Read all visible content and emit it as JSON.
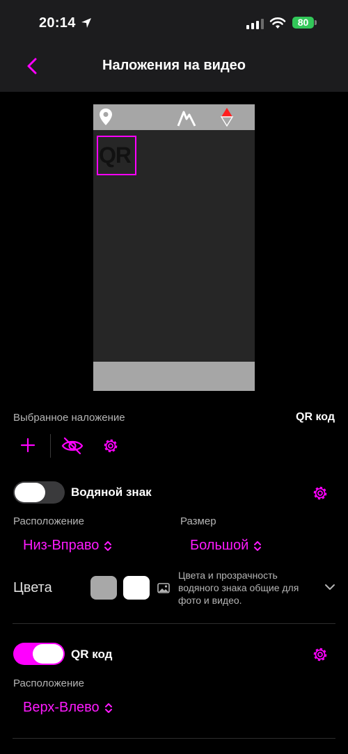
{
  "status_bar": {
    "time": "20:14",
    "battery": "80"
  },
  "nav": {
    "title": "Наложения на видео"
  },
  "selected_overlay": {
    "label": "Выбранное наложение",
    "value": "QR код"
  },
  "preview": {
    "qr_text": "QR"
  },
  "watermark": {
    "label": "Водяной знак",
    "enabled": false,
    "position_label": "Расположение",
    "position_value": "Низ-Вправо",
    "size_label": "Размер",
    "size_value": "Большой",
    "colors_label": "Цвета",
    "color_1": "#a8a8a8",
    "color_2": "#ffffff",
    "colors_note": "Цвета и прозрачность водяного знака общие для фото и видео."
  },
  "qr": {
    "label": "QR код",
    "enabled": true,
    "position_label": "Расположение",
    "position_value": "Верх-Влево"
  },
  "colors": {
    "accent": "#ff00ff",
    "nav_bg": "#1c1c1e",
    "battery": "#32c759"
  }
}
